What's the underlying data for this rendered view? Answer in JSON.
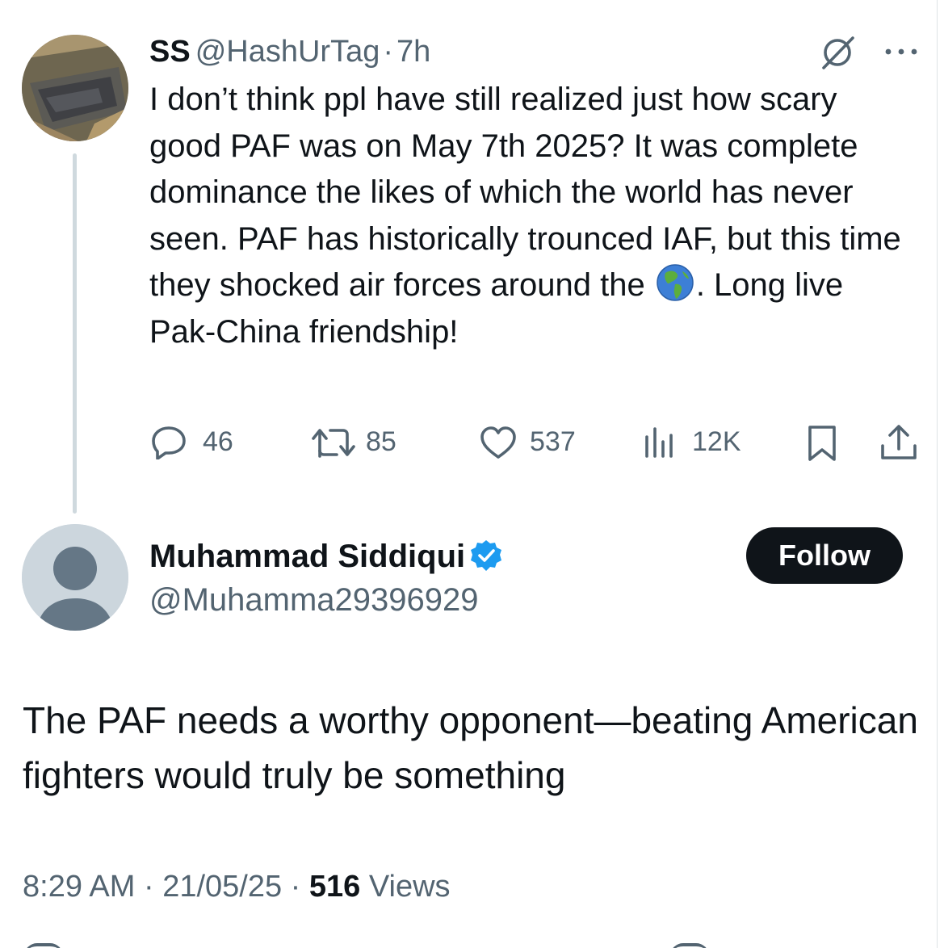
{
  "parent_tweet": {
    "author_name": "SS",
    "author_handle": "@HashUrTag",
    "separator": "·",
    "time": "7h",
    "text_before_emoji": "I don’t think ppl have still realized just how scary good PAF was on May 7th 2025? It was complete dominance the likes of which the world has never seen. PAF has historically trounced IAF, but this time they shocked air forces around the ",
    "emoji": "earth-americas-emoji",
    "text_after_emoji": ". Long live Pak-China friendship!",
    "stats": {
      "replies": "46",
      "reposts": "85",
      "likes": "537",
      "views": "12K"
    },
    "icons": {
      "grok": "grok-icon",
      "more": "more-icon",
      "reply": "reply-icon",
      "repost": "repost-icon",
      "like": "heart-icon",
      "views": "views-chart-icon",
      "bookmark": "bookmark-icon",
      "share": "share-icon"
    }
  },
  "reply_tweet": {
    "author_name": "Muhammad Siddiqui",
    "author_handle": "@Muhamma29396929",
    "verified": true,
    "follow_label": "Follow",
    "text": "The PAF needs a worthy opponent—beating American fighters would truly be something",
    "time": "8:29 AM",
    "separator": " · ",
    "date": "21/05/25",
    "views_count": "516",
    "views_label": "Views"
  },
  "colors": {
    "text_primary": "#0f1419",
    "text_secondary": "#536471",
    "verified_blue": "#1d9bf0",
    "thread_line": "#cfd9de",
    "button_bg": "#0f1419"
  }
}
